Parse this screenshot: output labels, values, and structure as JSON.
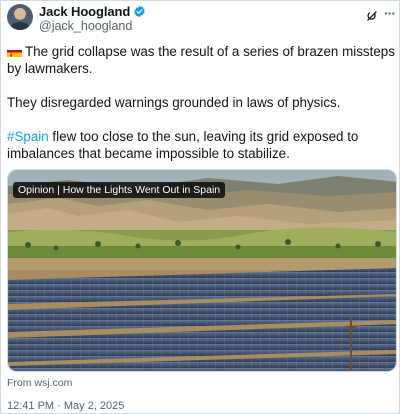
{
  "tweet": {
    "display_name": "Jack Hoogland",
    "handle": "@jack_hoogland",
    "paragraphs": {
      "p1": "The grid collapse was the result of a series of brazen missteps by lawmakers.",
      "p2": "They disregarded warnings grounded in laws of physics.",
      "p3_hashtag": "#Spain",
      "p3_rest": " flew too close to the sun, leaving its grid exposed to imbalances that became impossible to stabilize."
    },
    "flag_emoji_name": "spain-flag-icon",
    "card": {
      "caption": "Opinion | How the Lights Went Out in Spain",
      "source": "From wsj.com"
    },
    "timestamp": "12:41 PM · May 2, 2025"
  },
  "colors": {
    "text": "#0f1419",
    "secondary": "#536471",
    "link": "#1d9bf0",
    "verified": "#1d9bf0",
    "border": "#cfd9de"
  },
  "icons": [
    "verified-badge-icon",
    "grok-icon",
    "more-options-icon",
    "spain-flag-icon"
  ]
}
